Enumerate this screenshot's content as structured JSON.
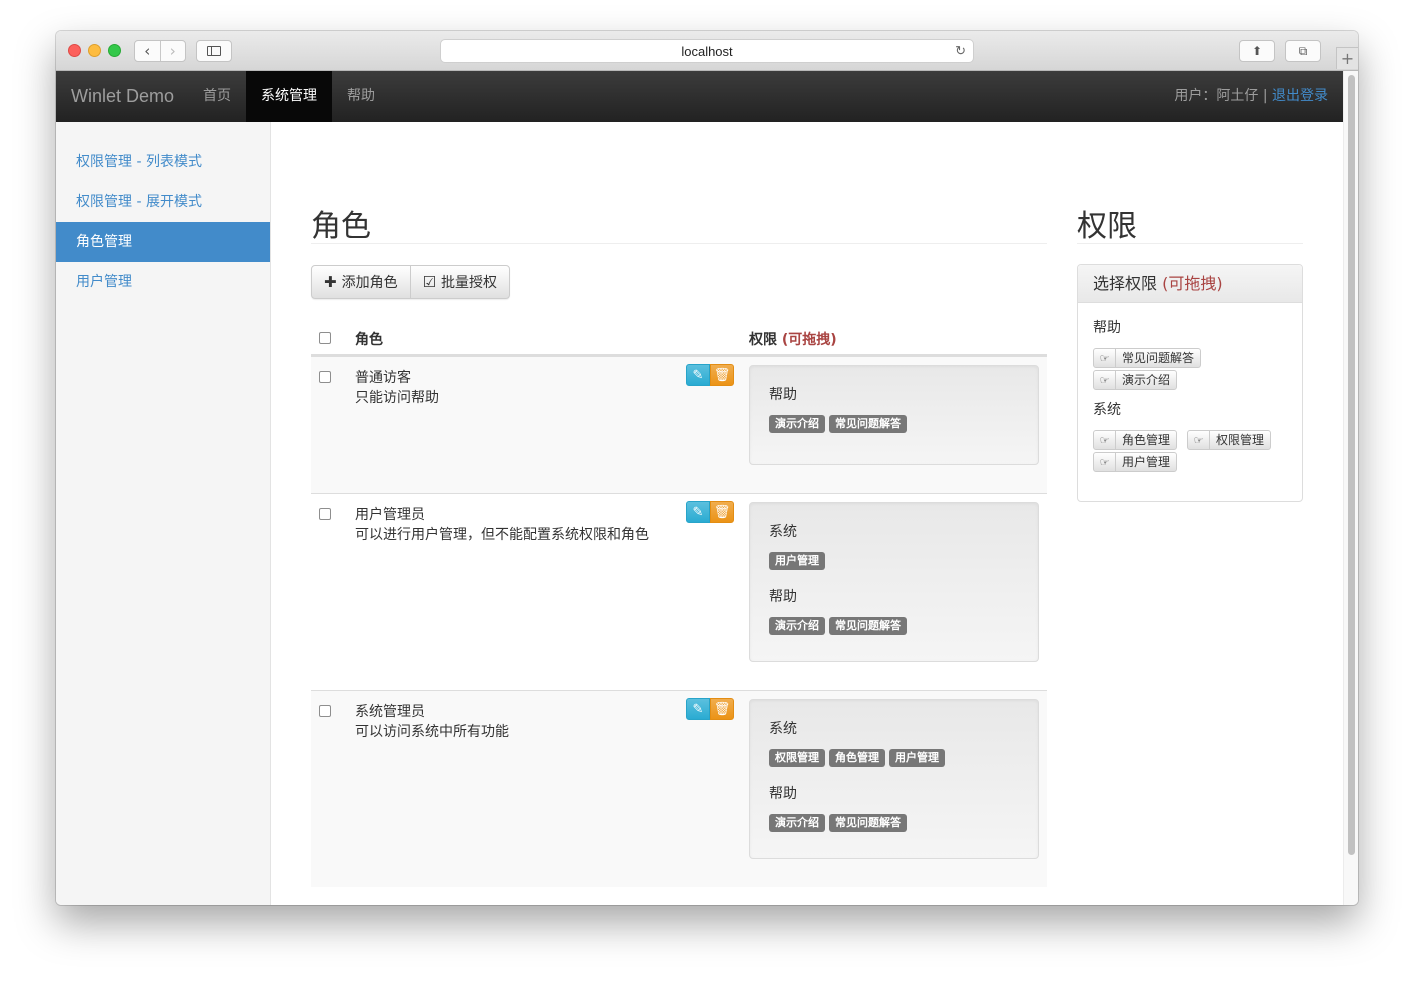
{
  "browser": {
    "url": "localhost"
  },
  "navbar": {
    "brand": "Winlet Demo",
    "items": [
      {
        "label": "首页"
      },
      {
        "label": "系统管理"
      },
      {
        "label": "帮助"
      }
    ],
    "user_label": "用户：",
    "user_name": "阿土仔",
    "separator": " | ",
    "logout": "退出登录"
  },
  "sidebar": {
    "items": [
      {
        "label": "权限管理 - 列表模式"
      },
      {
        "label": "权限管理 - 展开模式"
      },
      {
        "label": "角色管理"
      },
      {
        "label": "用户管理"
      }
    ]
  },
  "main": {
    "title": "角色",
    "add_button": "添加角色",
    "batch_button": "批量授权",
    "col_role": "角色",
    "col_perm": "权限",
    "drag_hint": "(可拖拽)",
    "rows": [
      {
        "name": "普通访客",
        "desc": "只能访问帮助",
        "groups": [
          {
            "title": "帮助",
            "tags": [
              "演示介绍",
              "常见问题解答"
            ]
          }
        ]
      },
      {
        "name": "用户管理员",
        "desc": "可以进行用户管理，但不能配置系统权限和角色",
        "groups": [
          {
            "title": "系统",
            "tags": [
              "用户管理"
            ]
          },
          {
            "title": "帮助",
            "tags": [
              "演示介绍",
              "常见问题解答"
            ]
          }
        ]
      },
      {
        "name": "系统管理员",
        "desc": "可以访问系统中所有功能",
        "groups": [
          {
            "title": "系统",
            "tags": [
              "权限管理",
              "角色管理",
              "用户管理"
            ]
          },
          {
            "title": "帮助",
            "tags": [
              "演示介绍",
              "常见问题解答"
            ]
          }
        ]
      }
    ]
  },
  "right": {
    "title": "权限",
    "panel_title": "选择权限",
    "drag_hint": "(可拖拽)",
    "groups": [
      {
        "title": "帮助",
        "items": [
          "常见问题解答",
          "演示介绍"
        ]
      },
      {
        "title": "系统",
        "items": [
          "角色管理",
          "权限管理",
          "用户管理"
        ]
      }
    ]
  }
}
